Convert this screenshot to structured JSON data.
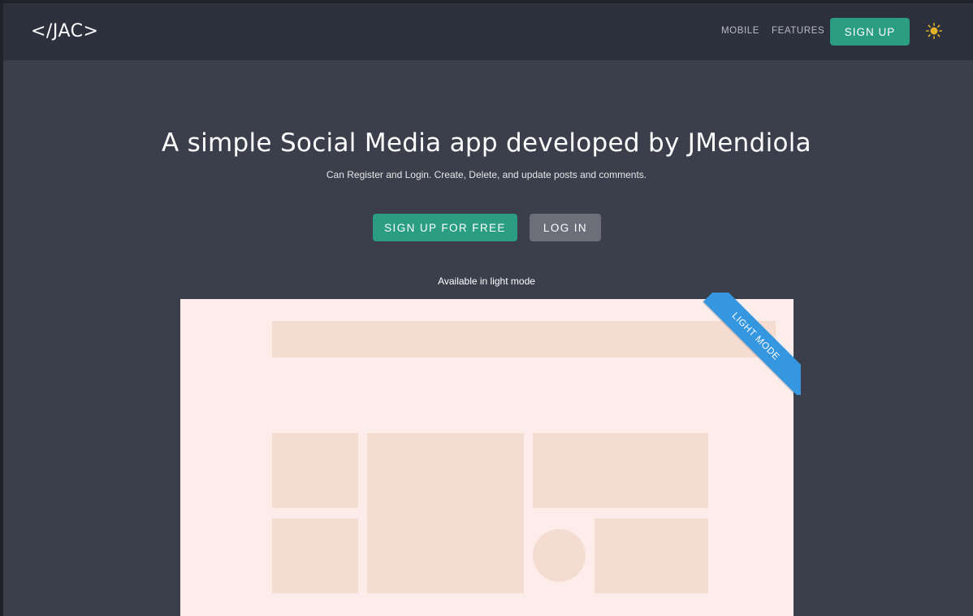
{
  "navbar": {
    "logo": "</JAC>",
    "links": [
      "MOBILE",
      "FEATURES"
    ],
    "signup_label": "SIGN UP",
    "theme_icon": "sun-icon",
    "theme_icon_color": "#e3b228"
  },
  "hero": {
    "title": "A simple Social Media app developed by JMendiola",
    "subtitle": "Can Register and Login. Create, Delete, and update posts and comments.",
    "primary_button": "SIGN UP FOR FREE",
    "secondary_button": "LOG IN",
    "availability_note": "Available in light mode"
  },
  "preview": {
    "ribbon_label": "LIGHT MODE",
    "ribbon_color": "#3597e0"
  },
  "colors": {
    "accent": "#2a9d82",
    "background": "#3a3f4b",
    "navbar": "#2d303d"
  }
}
